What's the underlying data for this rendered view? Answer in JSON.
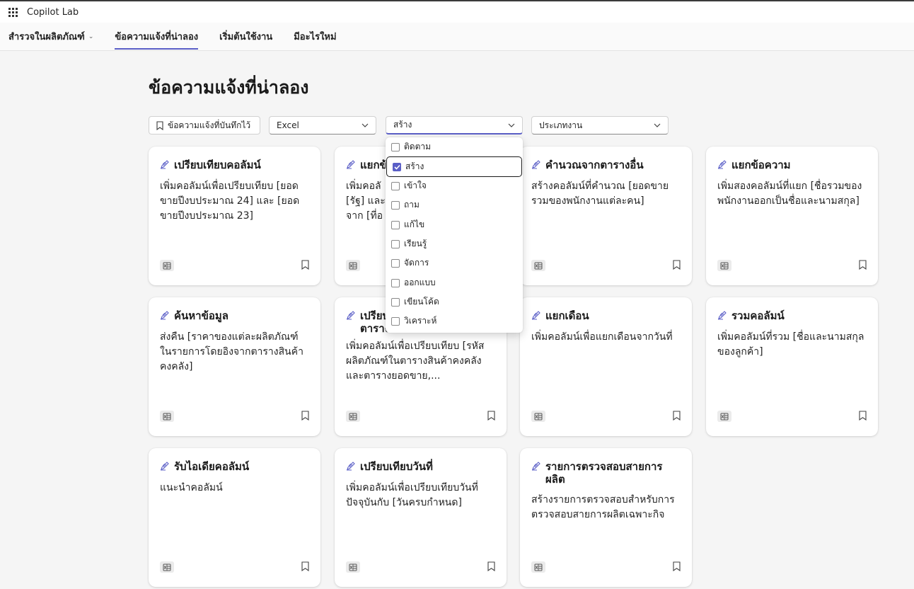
{
  "app": {
    "title": "Copilot Lab"
  },
  "nav": [
    {
      "label": "สำรวจในผลิตภัณฑ์",
      "has_chevron": true,
      "active": false
    },
    {
      "label": "ข้อความแจ้งที่น่าลอง",
      "has_chevron": false,
      "active": true
    },
    {
      "label": "เริ่มต้นใช้งาน",
      "has_chevron": false,
      "active": false
    },
    {
      "label": "มีอะไรใหม่",
      "has_chevron": false,
      "active": false
    }
  ],
  "page": {
    "title": "ข้อความแจ้งที่น่าลอง"
  },
  "filters": {
    "saved_label": "ข้อความแจ้งที่บันทึกไว้",
    "app_value": "Excel",
    "action_value": "สร้าง",
    "type_value": "ประเภทงาน"
  },
  "action_menu": {
    "options": [
      {
        "label": "ติดตาม",
        "checked": false
      },
      {
        "label": "สร้าง",
        "checked": true
      },
      {
        "label": "เข้าใจ",
        "checked": false
      },
      {
        "label": "ถาม",
        "checked": false
      },
      {
        "label": "แก้ไข",
        "checked": false
      },
      {
        "label": "เรียนรู้",
        "checked": false
      },
      {
        "label": "จัดการ",
        "checked": false
      },
      {
        "label": "ออกแบบ",
        "checked": false
      },
      {
        "label": "เขียนโค้ด",
        "checked": false
      },
      {
        "label": "วิเคราะห์",
        "checked": false
      }
    ]
  },
  "cards": [
    {
      "title": "เปรียบเทียบคอลัมน์",
      "desc": "เพิ่มคอลัมน์เพื่อเปรียบเทียบ [ยอดขายปีงบประมาณ 24] และ [ยอดขายปีงบประมาณ 23]"
    },
    {
      "title": "แยกข้",
      "desc": "เพิ่มคอลั [รัฐ] และ จาก [ที่อ"
    },
    {
      "title": "คำนวณจากตารางอื่น",
      "desc": "สร้างคอลัมน์ที่คำนวณ [ยอดขายรวมของพนักงานแต่ละคน]"
    },
    {
      "title": "แยกข้อความ",
      "desc": "เพิ่มสองคอลัมน์ที่แยก [ชื่อรวมของพนักงานออกเป็นชื่อและนามสกุล]"
    },
    {
      "title": "ค้นหาข้อมูล",
      "desc": "ส่งคืน [ราคาของแต่ละผลิตภัณฑ์ในรายการโดยอิงจากตารางสินค้าคงคลัง]"
    },
    {
      "title": "เปรียบ ตาราง",
      "desc": "เพิ่มคอลัมน์เพื่อเปรียบเทียบ [รหัสผลิตภัณฑ์ในตารางสินค้าคงคลังและตารางยอดขาย,..."
    },
    {
      "title": "แยกเดือน",
      "desc": "เพิ่มคอลัมน์เพื่อแยกเดือนจากวันที่"
    },
    {
      "title": "รวมคอลัมน์",
      "desc": "เพิ่มคอลัมน์ที่รวม [ชื่อและนามสกุลของลูกค้า]"
    },
    {
      "title": "รับไอเดียคอลัมน์",
      "desc": "แนะนำคอลัมน์"
    },
    {
      "title": "เปรียบเทียบวันที่",
      "desc": "เพิ่มคอลัมน์เพื่อเปรียบเทียบวันที่ปัจจุบันกับ [วันครบกำหนด]"
    },
    {
      "title": "รายการตรวจสอบสายการผลิต",
      "desc": "สร้างรายการตรวจสอบสำหรับการตรวจสอบสายการผลิตเฉพาะกิจ"
    }
  ],
  "colors": {
    "accent": "#5b5fc7",
    "page_bg": "#f5f5f5",
    "card_bg": "#ffffff"
  },
  "icons": {
    "card_title": "prompt-pen-icon",
    "app_badge": "excel-icon",
    "save": "bookmark-icon"
  }
}
